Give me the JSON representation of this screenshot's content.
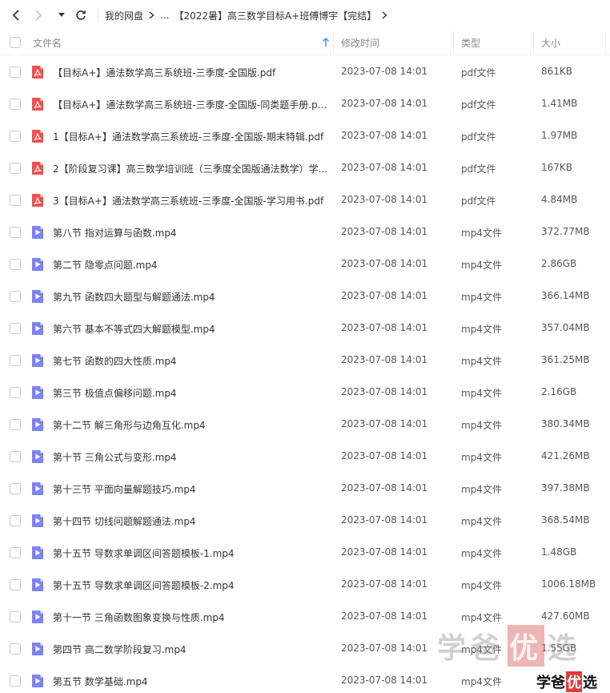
{
  "breadcrumb": {
    "root": "我的网盘",
    "ellipsis": "...",
    "current": "【2022暑】高三数学目标A+班傅博宇【完结】"
  },
  "columns": {
    "name": "文件名",
    "time": "修改时间",
    "type": "类型",
    "size": "大小"
  },
  "files": [
    {
      "icon": "pdf-file-icon",
      "name": "【目标A+】通法数学高三系统班-三季度-全国版.pdf",
      "time": "2023-07-08 14:01",
      "type": "pdf文件",
      "size": "861KB"
    },
    {
      "icon": "pdf-file-icon",
      "name": "【目标A+】通法数学高三系统班-三季度-全国版-同类题手册.p...",
      "time": "2023-07-08 14:01",
      "type": "pdf文件",
      "size": "1.41MB"
    },
    {
      "icon": "pdf-file-icon",
      "name": "1【目标A+】通法数学高三系统班-三季度-全国版-期末特辑.pdf",
      "time": "2023-07-08 14:01",
      "type": "pdf文件",
      "size": "1.97MB"
    },
    {
      "icon": "pdf-file-icon",
      "name": "2【阶段复习课】高三数学培训班（三季度全国版通法数学）学...",
      "time": "2023-07-08 14:01",
      "type": "pdf文件",
      "size": "167KB"
    },
    {
      "icon": "pdf-file-icon",
      "name": "3【目标A+】通法数学高三系统班-三季度-全国版-学习用书.pdf",
      "time": "2023-07-08 14:01",
      "type": "pdf文件",
      "size": "4.84MB"
    },
    {
      "icon": "video-file-icon",
      "name": "第八节 指对运算与函数.mp4",
      "time": "2023-07-08 14:01",
      "type": "mp4文件",
      "size": "372.77MB"
    },
    {
      "icon": "video-file-icon",
      "name": "第二节 隐零点问题.mp4",
      "time": "2023-07-08 14:01",
      "type": "mp4文件",
      "size": "2.86GB"
    },
    {
      "icon": "video-file-icon",
      "name": "第九节 函数四大题型与解题通法.mp4",
      "time": "2023-07-08 14:01",
      "type": "mp4文件",
      "size": "366.14MB"
    },
    {
      "icon": "video-file-icon",
      "name": "第六节 基本不等式四大解题模型.mp4",
      "time": "2023-07-08 14:01",
      "type": "mp4文件",
      "size": "357.04MB"
    },
    {
      "icon": "video-file-icon",
      "name": "第七节 函数的四大性质.mp4",
      "time": "2023-07-08 14:01",
      "type": "mp4文件",
      "size": "361.25MB"
    },
    {
      "icon": "video-file-icon",
      "name": "第三节 极值点偏移问题.mp4",
      "time": "2023-07-08 14:01",
      "type": "mp4文件",
      "size": "2.16GB"
    },
    {
      "icon": "video-file-icon",
      "name": "第十二节 解三角形与边角互化.mp4",
      "time": "2023-07-08 14:01",
      "type": "mp4文件",
      "size": "380.34MB"
    },
    {
      "icon": "video-file-icon",
      "name": "第十节 三角公式与变形.mp4",
      "time": "2023-07-08 14:01",
      "type": "mp4文件",
      "size": "421.26MB"
    },
    {
      "icon": "video-file-icon",
      "name": "第十三节 平面向量解题技巧.mp4",
      "time": "2023-07-08 14:01",
      "type": "mp4文件",
      "size": "397.38MB"
    },
    {
      "icon": "video-file-icon",
      "name": "第十四节 切线问题解题通法.mp4",
      "time": "2023-07-08 14:01",
      "type": "mp4文件",
      "size": "368.54MB"
    },
    {
      "icon": "video-file-icon",
      "name": "第十五节 导数求单调区间答题模板-1.mp4",
      "time": "2023-07-08 14:01",
      "type": "mp4文件",
      "size": "1.48GB"
    },
    {
      "icon": "video-file-icon",
      "name": "第十五节 导数求单调区间答题模板-2.mp4",
      "time": "2023-07-08 14:01",
      "type": "mp4文件",
      "size": "1006.18MB"
    },
    {
      "icon": "video-file-icon",
      "name": "第十一节 三角函数图象变换与性质.mp4",
      "time": "2023-07-08 14:01",
      "type": "mp4文件",
      "size": "427.60MB"
    },
    {
      "icon": "video-file-icon",
      "name": "第四节 高二数学阶段复习.mp4",
      "time": "2023-07-08 14:01",
      "type": "mp4文件",
      "size": "1.55GB"
    },
    {
      "icon": "video-file-icon",
      "name": "第五节 数学基础.mp4",
      "time": "2023-07-08 14:01",
      "type": "mp4文件",
      "size": ""
    }
  ],
  "watermark": {
    "part1": "学爸",
    "part2": "优",
    "part3": "选"
  },
  "logo": {
    "part1": "学爸",
    "part2": "优",
    "part3": "选"
  },
  "colors": {
    "pdf_icon": "#f0524f",
    "video_icon": "#7b83f6"
  }
}
